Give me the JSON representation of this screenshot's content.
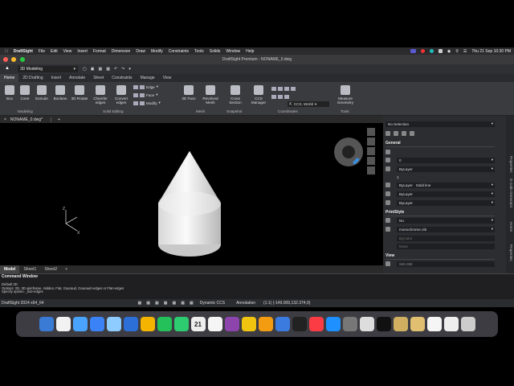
{
  "menubar": {
    "items": [
      "DraftSight",
      "File",
      "Edit",
      "View",
      "Insert",
      "Format",
      "Dimension",
      "Draw",
      "Modify",
      "Constraints",
      "Tools",
      "Solids",
      "Window",
      "Help"
    ],
    "clock": "Thu 21 Sep  10:30 PM"
  },
  "window": {
    "title": "DraftSight Premium - NONAME_0.dwg"
  },
  "qat": {
    "workspace": "3D Modeling"
  },
  "ribbon_tabs": [
    "Home",
    "2D Drafting",
    "Insert",
    "Annotate",
    "Sheet",
    "Constraints",
    "Manage",
    "View"
  ],
  "ribbon": {
    "buttons": [
      {
        "label": "Box"
      },
      {
        "label": "Cone"
      },
      {
        "label": "Extrude"
      },
      {
        "label": "Boolean"
      },
      {
        "label": "3D Rotate"
      },
      {
        "label": "Chamfer edges"
      },
      {
        "label": "Convert edges"
      },
      {
        "label": "3D Face"
      },
      {
        "label": "Revolved Mesh"
      },
      {
        "label": "Cross Section"
      },
      {
        "label": "CCS Manager"
      },
      {
        "label": "Measure Geometry"
      }
    ],
    "small": [
      "Edge",
      "Face",
      "Modify"
    ],
    "ccs_value": "CCS, World",
    "groups": [
      "Modeling",
      "Solid Editing",
      "Mesh",
      "Snapshot",
      "Coordinates",
      "Tools"
    ]
  },
  "doc_tab": "NONAME_0.dwg*",
  "layout_tabs": [
    "Model",
    "Sheet1",
    "Sheet2"
  ],
  "axis": {
    "z": "Z",
    "x": "X"
  },
  "panel": {
    "selection": "No Selection",
    "general_header": "General",
    "layer": "0",
    "color": "ByLayer",
    "scale": "1",
    "linetype": "ByLayer",
    "linestyle": "Solid line",
    "lineweight": "ByLayer",
    "transparency": "ByLayer",
    "print_header": "PrintStyle",
    "print_no": "No",
    "print_table": "monochrome.ctb",
    "print_color": "ByColor",
    "print_none": "None",
    "view_header": "View",
    "view_value": "556.058",
    "side_tabs": [
      "Properties",
      "G-code Generator",
      "Home",
      "Properties"
    ]
  },
  "command": {
    "title": "Command Window",
    "lines": [
      "Default 3D",
      "Options: 2D, 3D wireframe, Hidden, Flat, Gouraud, Gouraud+edges or Flat+edges",
      "Specify option» _flat+edges"
    ]
  },
  "status": {
    "version": "DraftSight 2024 x64_64",
    "dynamic": "Dynamic CCS",
    "annotation": "Annotation",
    "coords": "(1:1)   (-149.009,132.374,0)"
  },
  "dock_colors": [
    "#3a7bd5",
    "#f2f2f2",
    "#4aa3ff",
    "#3b82f6",
    "#8ecbff",
    "#2c6fd6",
    "#f4b400",
    "#24c15a",
    "#2ecc71",
    "#eeeeee",
    "#f5f5f5",
    "#8e44ad",
    "#f1c40f",
    "#f39c12",
    "#3b7be0",
    "#222",
    "#fc3c44",
    "#1e90ff",
    "#777",
    "#ddd",
    "#111",
    "#d0b060",
    "#e0c070",
    "#f5f5f5",
    "#eeeeee",
    "#cccccc"
  ],
  "dock_date": "21"
}
